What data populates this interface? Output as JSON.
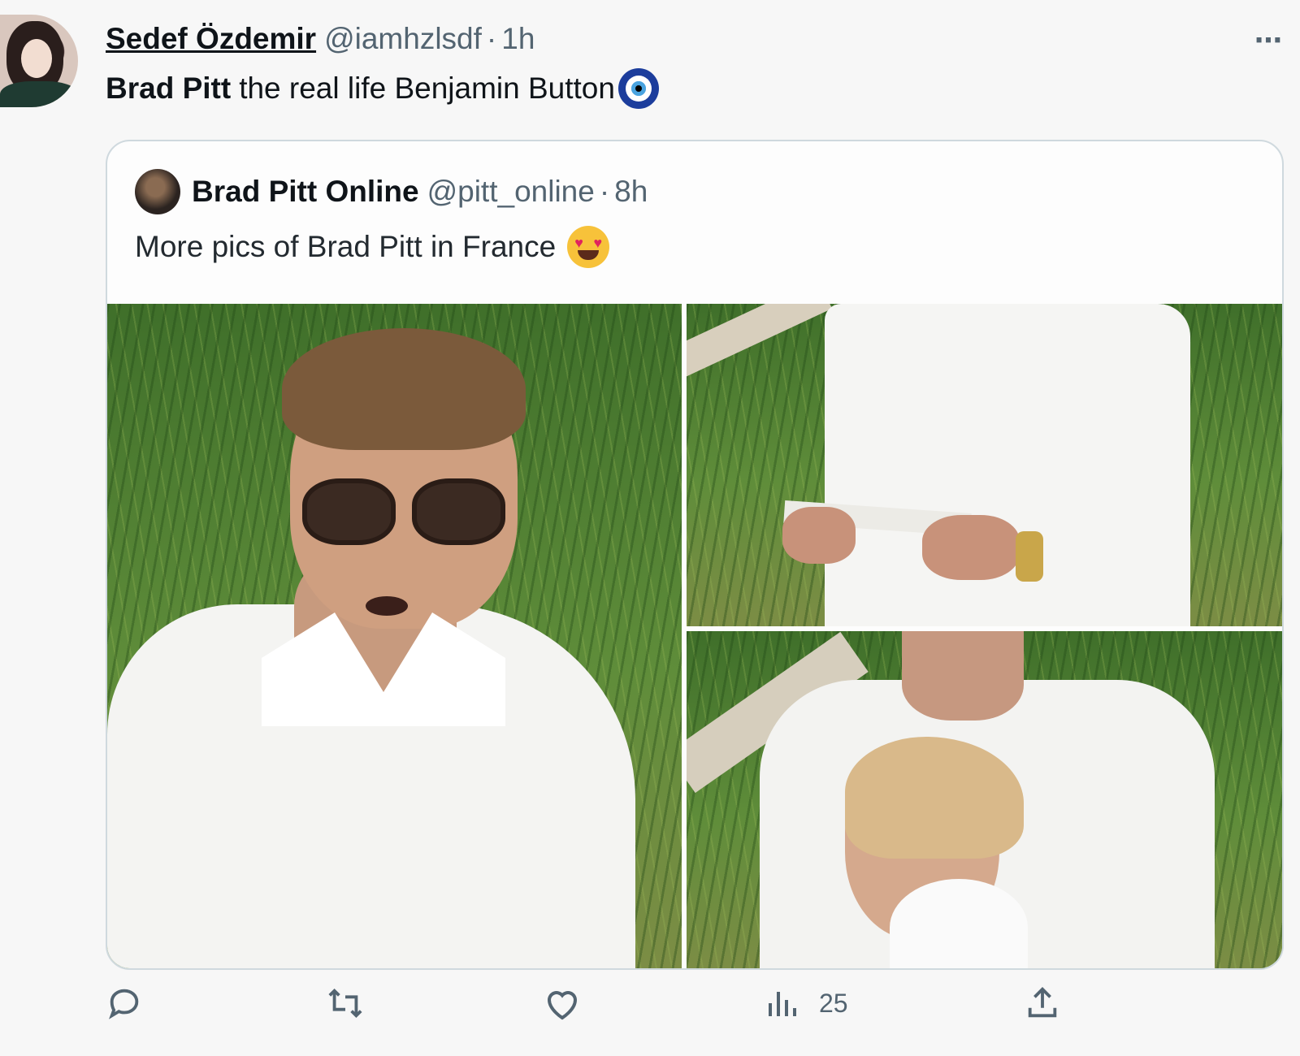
{
  "tweet": {
    "author_name": "Sedef Özdemir",
    "handle": "@iamhzlsdf",
    "separator": "·",
    "time": "1h",
    "text_bold": "Brad Pitt",
    "text_rest": "the real life Benjamin Button",
    "emoji": "nazar-amulet-icon",
    "more_icon": "⋯"
  },
  "quoted": {
    "author_name": "Brad Pitt Online",
    "handle": "@pitt_online",
    "separator": "·",
    "time": "8h",
    "text": "More pics of Brad Pitt in France",
    "emoji": "heart-eyes-icon",
    "photos": [
      "photo-portrait-sunglasses",
      "photo-reading-paper",
      "photo-with-woman"
    ]
  },
  "actions": {
    "reply_icon": "reply-icon",
    "retweet_icon": "retweet-icon",
    "like_icon": "like-icon",
    "views_icon": "views-icon",
    "views_count": "25",
    "share_icon": "share-icon"
  },
  "colors": {
    "text_primary": "#0f1419",
    "text_secondary": "#536471",
    "border": "#cfd9de",
    "background": "#f7f7f7"
  }
}
